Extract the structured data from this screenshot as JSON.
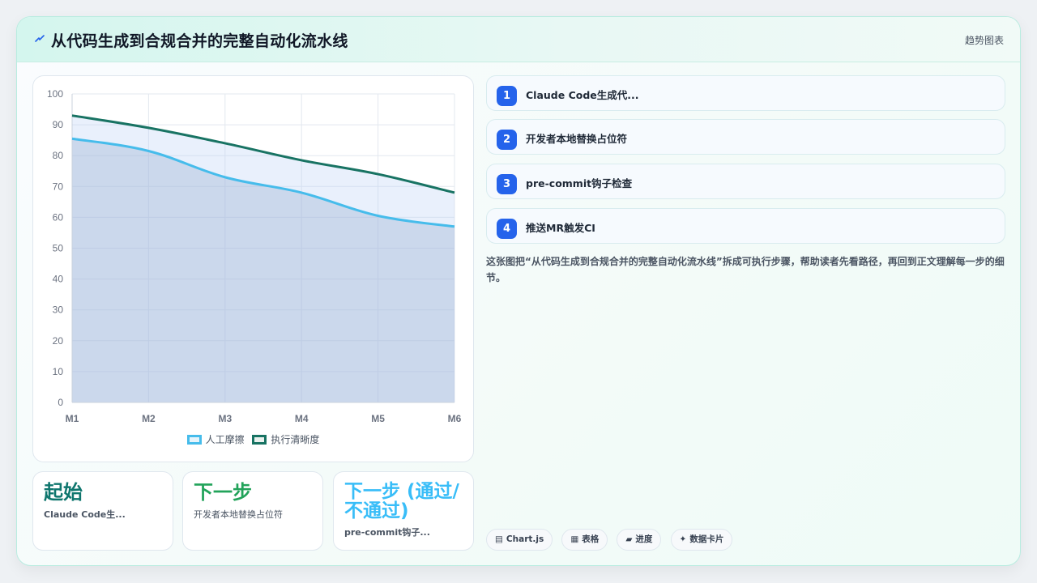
{
  "header": {
    "title": "从代码生成到合规合并的完整自动化流水线",
    "tag": "趋势图表"
  },
  "chart_data": {
    "type": "area",
    "categories": [
      "M1",
      "M2",
      "M3",
      "M4",
      "M5",
      "M6"
    ],
    "y_ticks": [
      "100",
      "90",
      "80",
      "70",
      "60",
      "50",
      "40",
      "30",
      "20",
      "10",
      "0"
    ],
    "ylim": [
      0,
      100
    ],
    "grid": true,
    "legend_position": "bottom",
    "series": [
      {
        "name": "人工摩擦",
        "values": [
          85.5,
          81.5,
          73,
          68,
          60.5,
          57
        ],
        "color": "#46bceb",
        "fill": "rgba(148,170,204,0.34)"
      },
      {
        "name": "执行清晰度",
        "values": [
          93,
          89,
          84,
          78.5,
          74,
          68
        ],
        "color": "#187363",
        "fill": "rgba(188,208,247,0.33)"
      }
    ]
  },
  "stats": [
    {
      "value": "起始",
      "label": "Claude Code生..."
    },
    {
      "value": "下一步",
      "label": "开发者本地替换占位符"
    },
    {
      "value": "下一步 (通过/不通过)",
      "label": "pre-commit钩子..."
    }
  ],
  "steps": [
    {
      "num": "1",
      "label": "Claude Code生成代..."
    },
    {
      "num": "2",
      "label": "开发者本地替换占位符"
    },
    {
      "num": "3",
      "label": "pre-commit钩子检查"
    },
    {
      "num": "4",
      "label": "推送MR触发CI"
    }
  ],
  "description": "这张图把“从代码生成到合规合并的完整自动化流水线”拆成可执行步骤，帮助读者先看路径，再回到正文理解每一步的细节。",
  "chips": [
    {
      "icon": "chart-icon",
      "glyph": "▤",
      "label": "Chart.js"
    },
    {
      "icon": "table-icon",
      "glyph": "▦",
      "label": "表格"
    },
    {
      "icon": "progress-icon",
      "glyph": "▰",
      "label": "进度"
    },
    {
      "icon": "sparkle-icon",
      "glyph": "✦",
      "label": "数据卡片"
    }
  ],
  "colors": {
    "accent": "#2563eb",
    "teal": "#0f766e",
    "green": "#22a35a",
    "sky": "#38bdf8"
  }
}
